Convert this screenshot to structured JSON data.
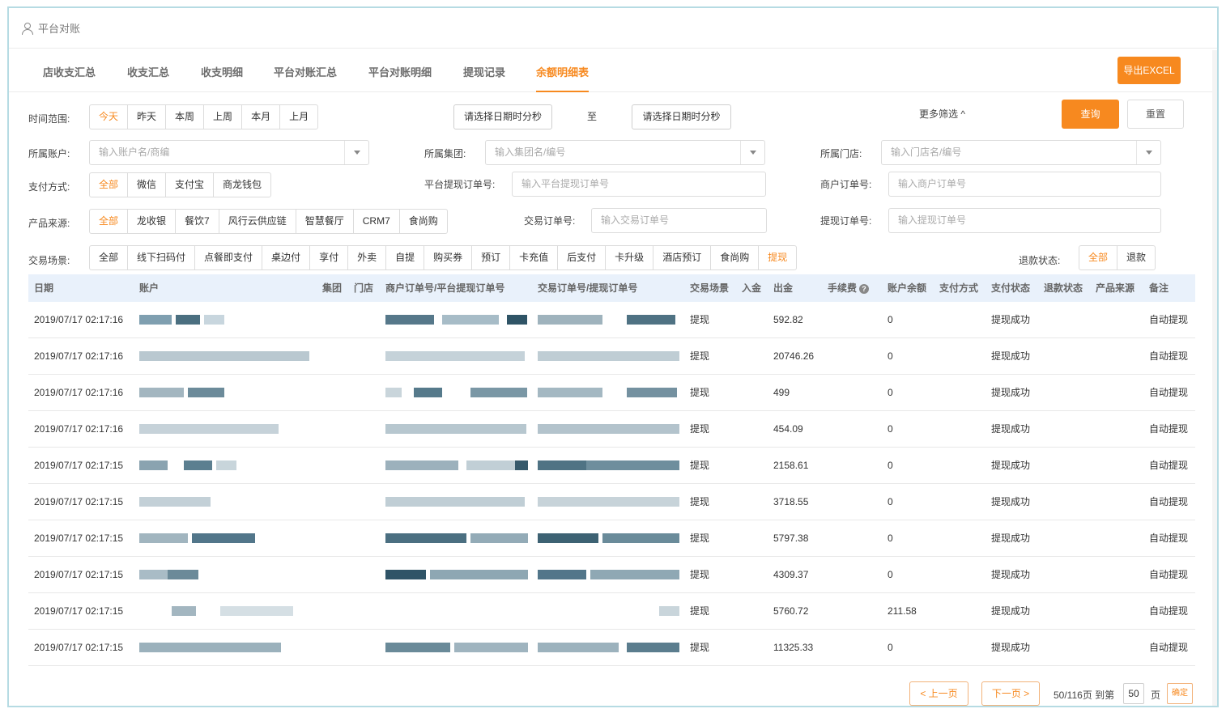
{
  "app": {
    "title": "平台对账",
    "user_icon": "user-icon"
  },
  "tabs": [
    "店收支汇总",
    "收支汇总",
    "收支明细",
    "平台对账汇总",
    "平台对账明细",
    "提现记录",
    "余额明细表"
  ],
  "active_tab": 6,
  "export_label": "导出EXCEL",
  "filters": {
    "time_range": {
      "label": "时间范围:",
      "options": [
        "今天",
        "昨天",
        "本周",
        "上周",
        "本月",
        "上月"
      ],
      "selected": 0,
      "start_placeholder": "请选择日期时分秒",
      "to_label": "至",
      "end_placeholder": "请选择日期时分秒"
    },
    "more_filter": "更多筛选 ^",
    "query_label": "查询",
    "reset_label": "重置",
    "account": {
      "label": "所属账户:",
      "placeholder": "输入账户名/商编"
    },
    "group": {
      "label": "所属集团:",
      "placeholder": "输入集团名/编号"
    },
    "store": {
      "label": "所属门店:",
      "placeholder": "输入门店名/编号"
    },
    "pay_method": {
      "label": "支付方式:",
      "options": [
        "全部",
        "微信",
        "支付宝",
        "商龙钱包"
      ],
      "selected": 0
    },
    "platform_withdraw_no": {
      "label": "平台提现订单号:",
      "placeholder": "输入平台提现订单号"
    },
    "merchant_order_no": {
      "label": "商户订单号:",
      "placeholder": "输入商户订单号"
    },
    "product_source": {
      "label": "产品来源:",
      "options": [
        "全部",
        "龙收银",
        "餐饮7",
        "风行云供应链",
        "智慧餐厅",
        "CRM7",
        "食尚购"
      ],
      "selected": 0
    },
    "trade_no": {
      "label": "交易订单号:",
      "placeholder": "输入交易订单号"
    },
    "withdraw_no": {
      "label": "提现订单号:",
      "placeholder": "输入提现订单号"
    },
    "scene": {
      "label": "交易场景:",
      "options": [
        "全部",
        "线下扫码付",
        "点餐即支付",
        "桌边付",
        "享付",
        "外卖",
        "自提",
        "购买券",
        "预订",
        "卡充值",
        "后支付",
        "卡升级",
        "酒店预订",
        "食尚购",
        "提现"
      ],
      "selected": 14
    },
    "refund_status": {
      "label": "退款状态:",
      "options": [
        "全部",
        "退款"
      ],
      "selected": 0
    }
  },
  "table": {
    "headers": [
      "日期",
      "账户",
      "集团",
      "门店",
      "商户订单号/平台提现订单号",
      "交易订单号/提现订单号",
      "交易场景",
      "入金",
      "出金",
      "手续费",
      "账户余额",
      "支付方式",
      "支付状态",
      "退款状态",
      "产品来源",
      "备注"
    ],
    "info_icon": "info-icon",
    "rows": [
      {
        "date": "2019/07/17 02:17:16",
        "scene": "提现",
        "amount_out": "592.82",
        "balance": "0",
        "pay_status": "提现成功",
        "remark": "自动提现"
      },
      {
        "date": "2019/07/17 02:17:16",
        "scene": "提现",
        "amount_out": "20746.26",
        "balance": "0",
        "pay_status": "提现成功",
        "remark": "自动提现"
      },
      {
        "date": "2019/07/17 02:17:16",
        "scene": "提现",
        "amount_out": "499",
        "balance": "0",
        "pay_status": "提现成功",
        "remark": "自动提现"
      },
      {
        "date": "2019/07/17 02:17:16",
        "scene": "提现",
        "amount_out": "454.09",
        "balance": "0",
        "pay_status": "提现成功",
        "remark": "自动提现"
      },
      {
        "date": "2019/07/17 02:17:15",
        "scene": "提现",
        "amount_out": "2158.61",
        "balance": "0",
        "pay_status": "提现成功",
        "remark": "自动提现"
      },
      {
        "date": "2019/07/17 02:17:15",
        "scene": "提现",
        "amount_out": "3718.55",
        "balance": "0",
        "pay_status": "提现成功",
        "remark": "自动提现"
      },
      {
        "date": "2019/07/17 02:17:15",
        "scene": "提现",
        "amount_out": "5797.38",
        "balance": "0",
        "pay_status": "提现成功",
        "remark": "自动提现"
      },
      {
        "date": "2019/07/17 02:17:15",
        "scene": "提现",
        "amount_out": "4309.37",
        "balance": "0",
        "pay_status": "提现成功",
        "remark": "自动提现"
      },
      {
        "date": "2019/07/17 02:17:15",
        "scene": "提现",
        "amount_out": "5760.72",
        "balance": "211.58",
        "pay_status": "提现成功",
        "remark": "自动提现"
      },
      {
        "date": "2019/07/17 02:17:15",
        "scene": "提现",
        "amount_out": "11325.33",
        "balance": "0",
        "pay_status": "提现成功",
        "remark": "自动提现"
      }
    ]
  },
  "pagination": {
    "prev_label": "< 上一页",
    "next_label": "下一页 >",
    "summary": "50/116页 到第",
    "page_value": "50",
    "page_unit": "页",
    "confirm_label": "确定"
  },
  "colors": {
    "accent": "#f7891f",
    "header_bg": "#e9f1fb",
    "border": "#dcdcdc"
  }
}
